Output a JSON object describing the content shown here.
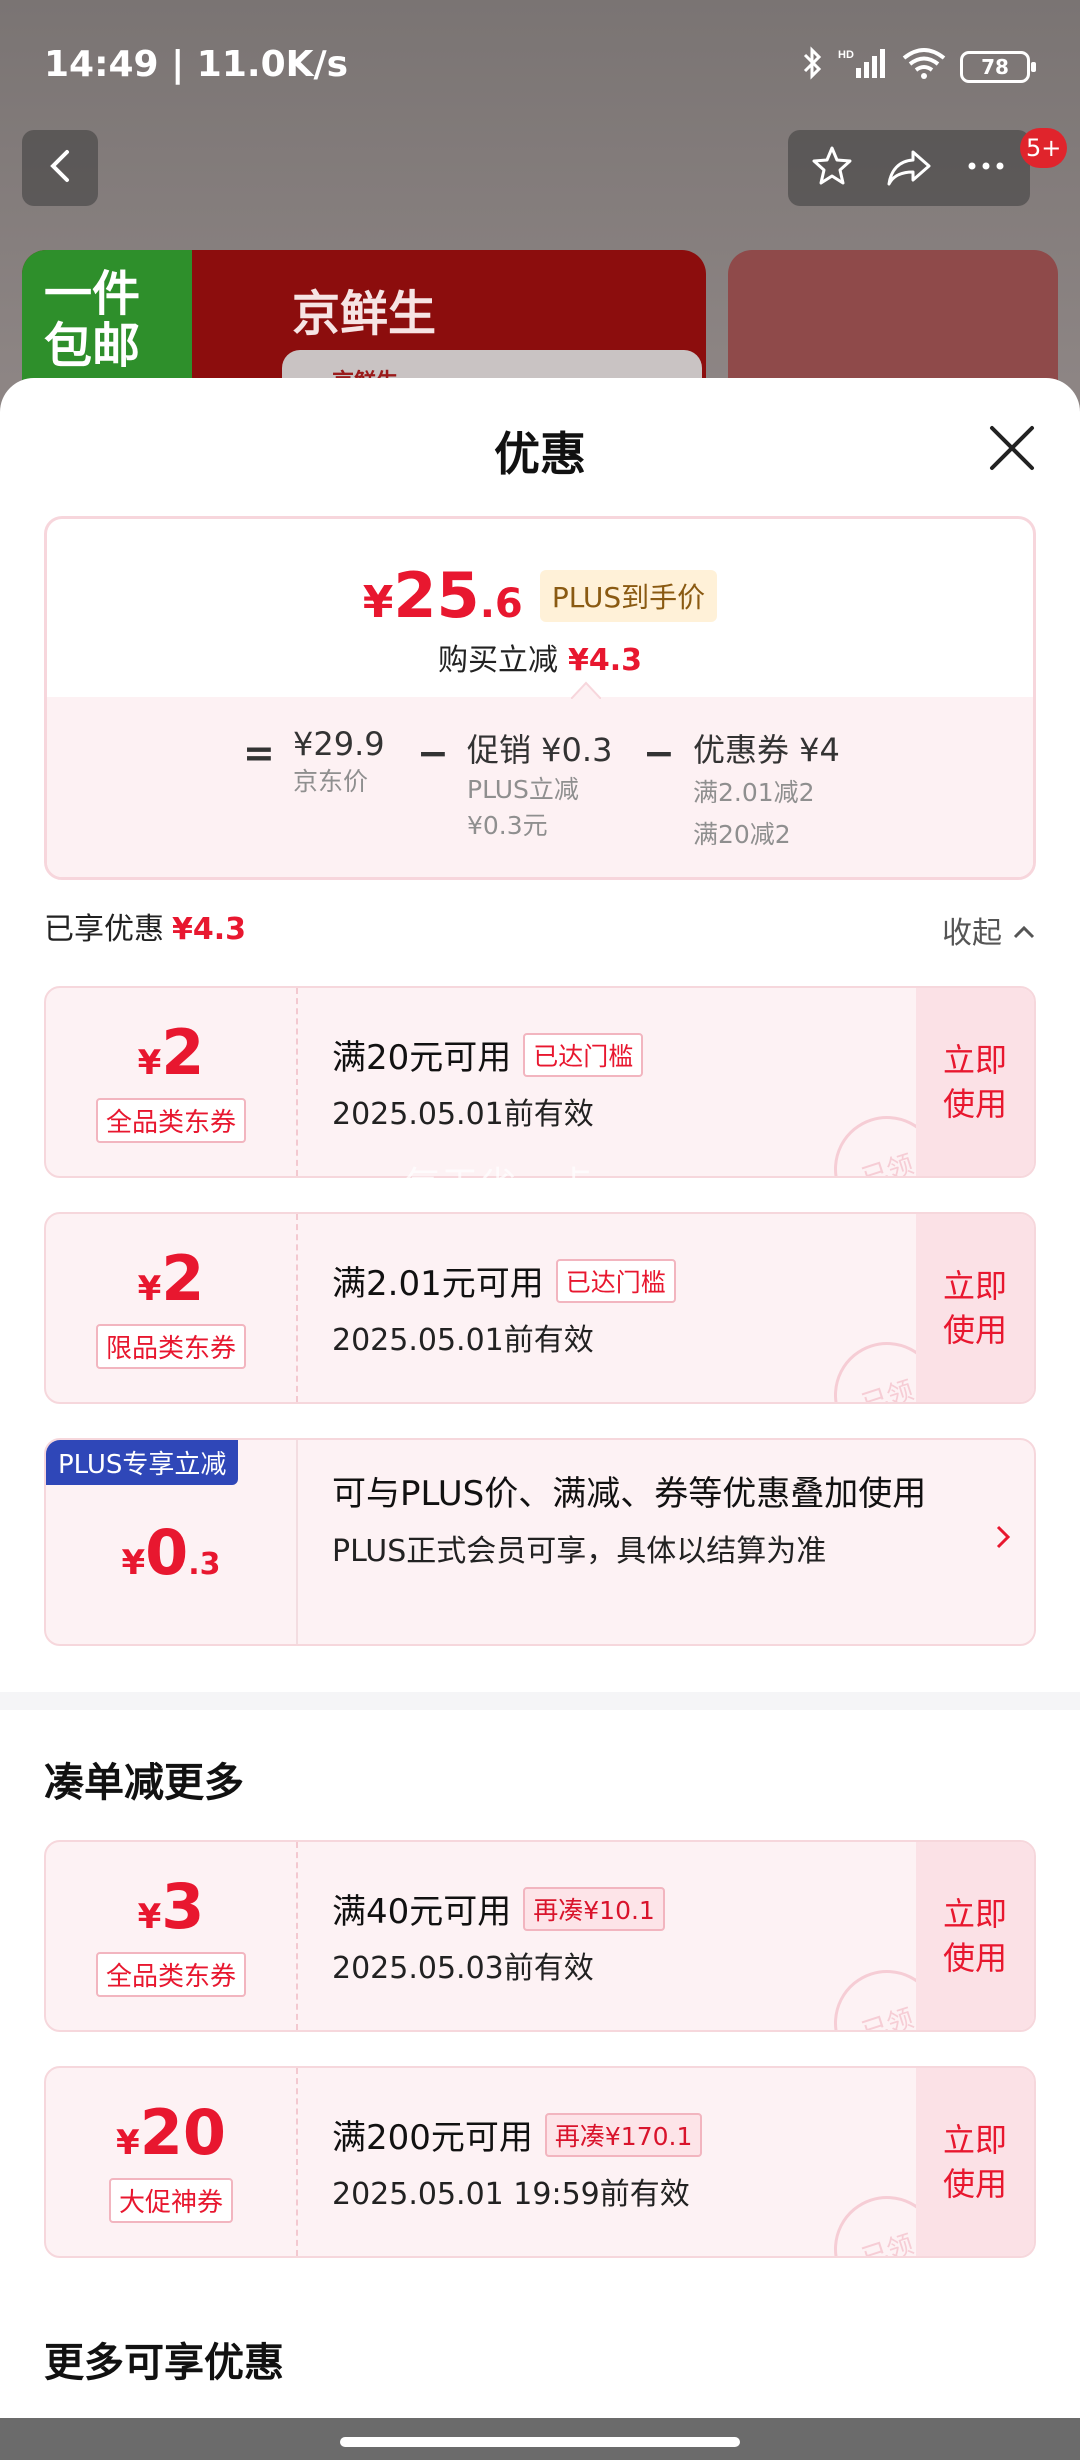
{
  "status_bar": {
    "time": "14:49 | 11.0K/s",
    "battery": "78"
  },
  "nav": {
    "badge": "5+"
  },
  "background": {
    "free_ship": "一件\n包邮",
    "brand": "京鲜生",
    "brand_mini": "京鲜生"
  },
  "sheet": {
    "title": "优惠",
    "summary": {
      "yen": "¥",
      "price_int": "25",
      "price_dec": ".6",
      "plus_label": "PLUS到手价",
      "instant_label": "购买立减",
      "instant_value": "¥4.3",
      "eq": "=",
      "base_price": "¥29.9",
      "base_label": "京东价",
      "minus1": "−",
      "promo_title": "促销 ¥0.3",
      "promo_line1": "PLUS立减",
      "promo_line2": "¥0.3元",
      "minus2": "−",
      "coupon_title": "优惠券 ¥4",
      "coupon_line1": "满2.01减2",
      "coupon_line2": "满20减2"
    },
    "enjoyed_label": "已享优惠",
    "enjoyed_value": "¥4.3",
    "collapse_label": "收起",
    "coupons": [
      {
        "yen": "¥",
        "amount": "2",
        "tag": "全品类东券",
        "condition": "满20元可用",
        "badge": "已达门槛",
        "valid": "2025.05.01前有效",
        "use": "立即使用",
        "stamp": "已领"
      },
      {
        "yen": "¥",
        "amount": "2",
        "tag": "限品类东券",
        "condition": "满2.01元可用",
        "badge": "已达门槛",
        "valid": "2025.05.01前有效",
        "use": "立即使用",
        "stamp": "已领"
      }
    ],
    "plus": {
      "tag": "PLUS专享立减",
      "yen": "¥",
      "amount_int": "0",
      "amount_dec": ".3",
      "title": "可与PLUS价、满减、券等优惠叠加使用",
      "desc": "PLUS正式会员可享，具体以结算为准"
    },
    "section_more": "凑单减更多",
    "more_coupons": [
      {
        "yen": "¥",
        "amount": "3",
        "tag": "全品类东券",
        "condition": "满40元可用",
        "badge": "再凑¥10.1",
        "valid": "2025.05.03前有效",
        "use": "立即使用",
        "stamp": "已领"
      },
      {
        "yen": "¥",
        "amount": "20",
        "tag": "大促神券",
        "condition": "满200元可用",
        "badge": "再凑¥170.1",
        "valid": "2025.05.01 19:59前有效",
        "use": "立即使用",
        "stamp": "已领"
      }
    ],
    "section_extra": "更多可享优惠",
    "watermark": "每天省一点"
  },
  "colors": {
    "accent_red": "#e8172f",
    "plus_blue": "#2f47b8",
    "card_bg": "#fdf2f4"
  },
  "icons": [
    "back-arrow-icon",
    "star-icon",
    "share-icon",
    "more-icon",
    "close-icon",
    "chevron-up-icon",
    "chevron-right-icon",
    "bluetooth-icon",
    "signal-icon",
    "wifi-icon",
    "battery-icon"
  ]
}
